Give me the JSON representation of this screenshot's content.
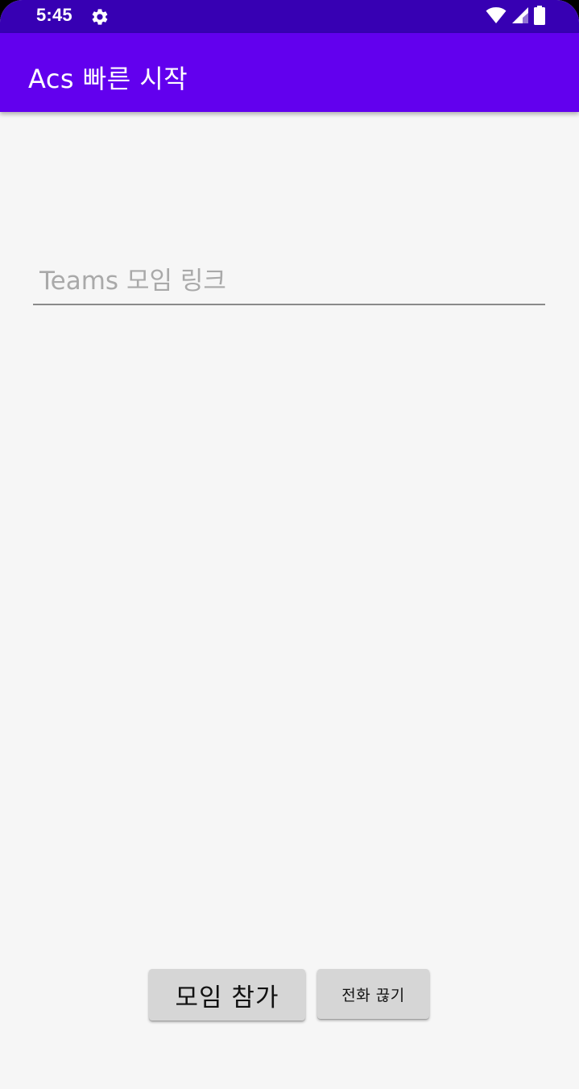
{
  "status_bar": {
    "time": "5:45",
    "settings_icon": "gear-icon",
    "wifi_icon": "wifi-icon",
    "signal_icon": "signal-icon",
    "battery_icon": "battery-icon",
    "background_color": "#3700b3"
  },
  "app_bar": {
    "title": "Acs 빠른 시작",
    "background_color": "#6200ee"
  },
  "form": {
    "meeting_link": {
      "value": "",
      "placeholder": "Teams 모임 링크"
    }
  },
  "actions": {
    "join_label": "모임 참가",
    "hangup_label": "전화 끊기"
  }
}
